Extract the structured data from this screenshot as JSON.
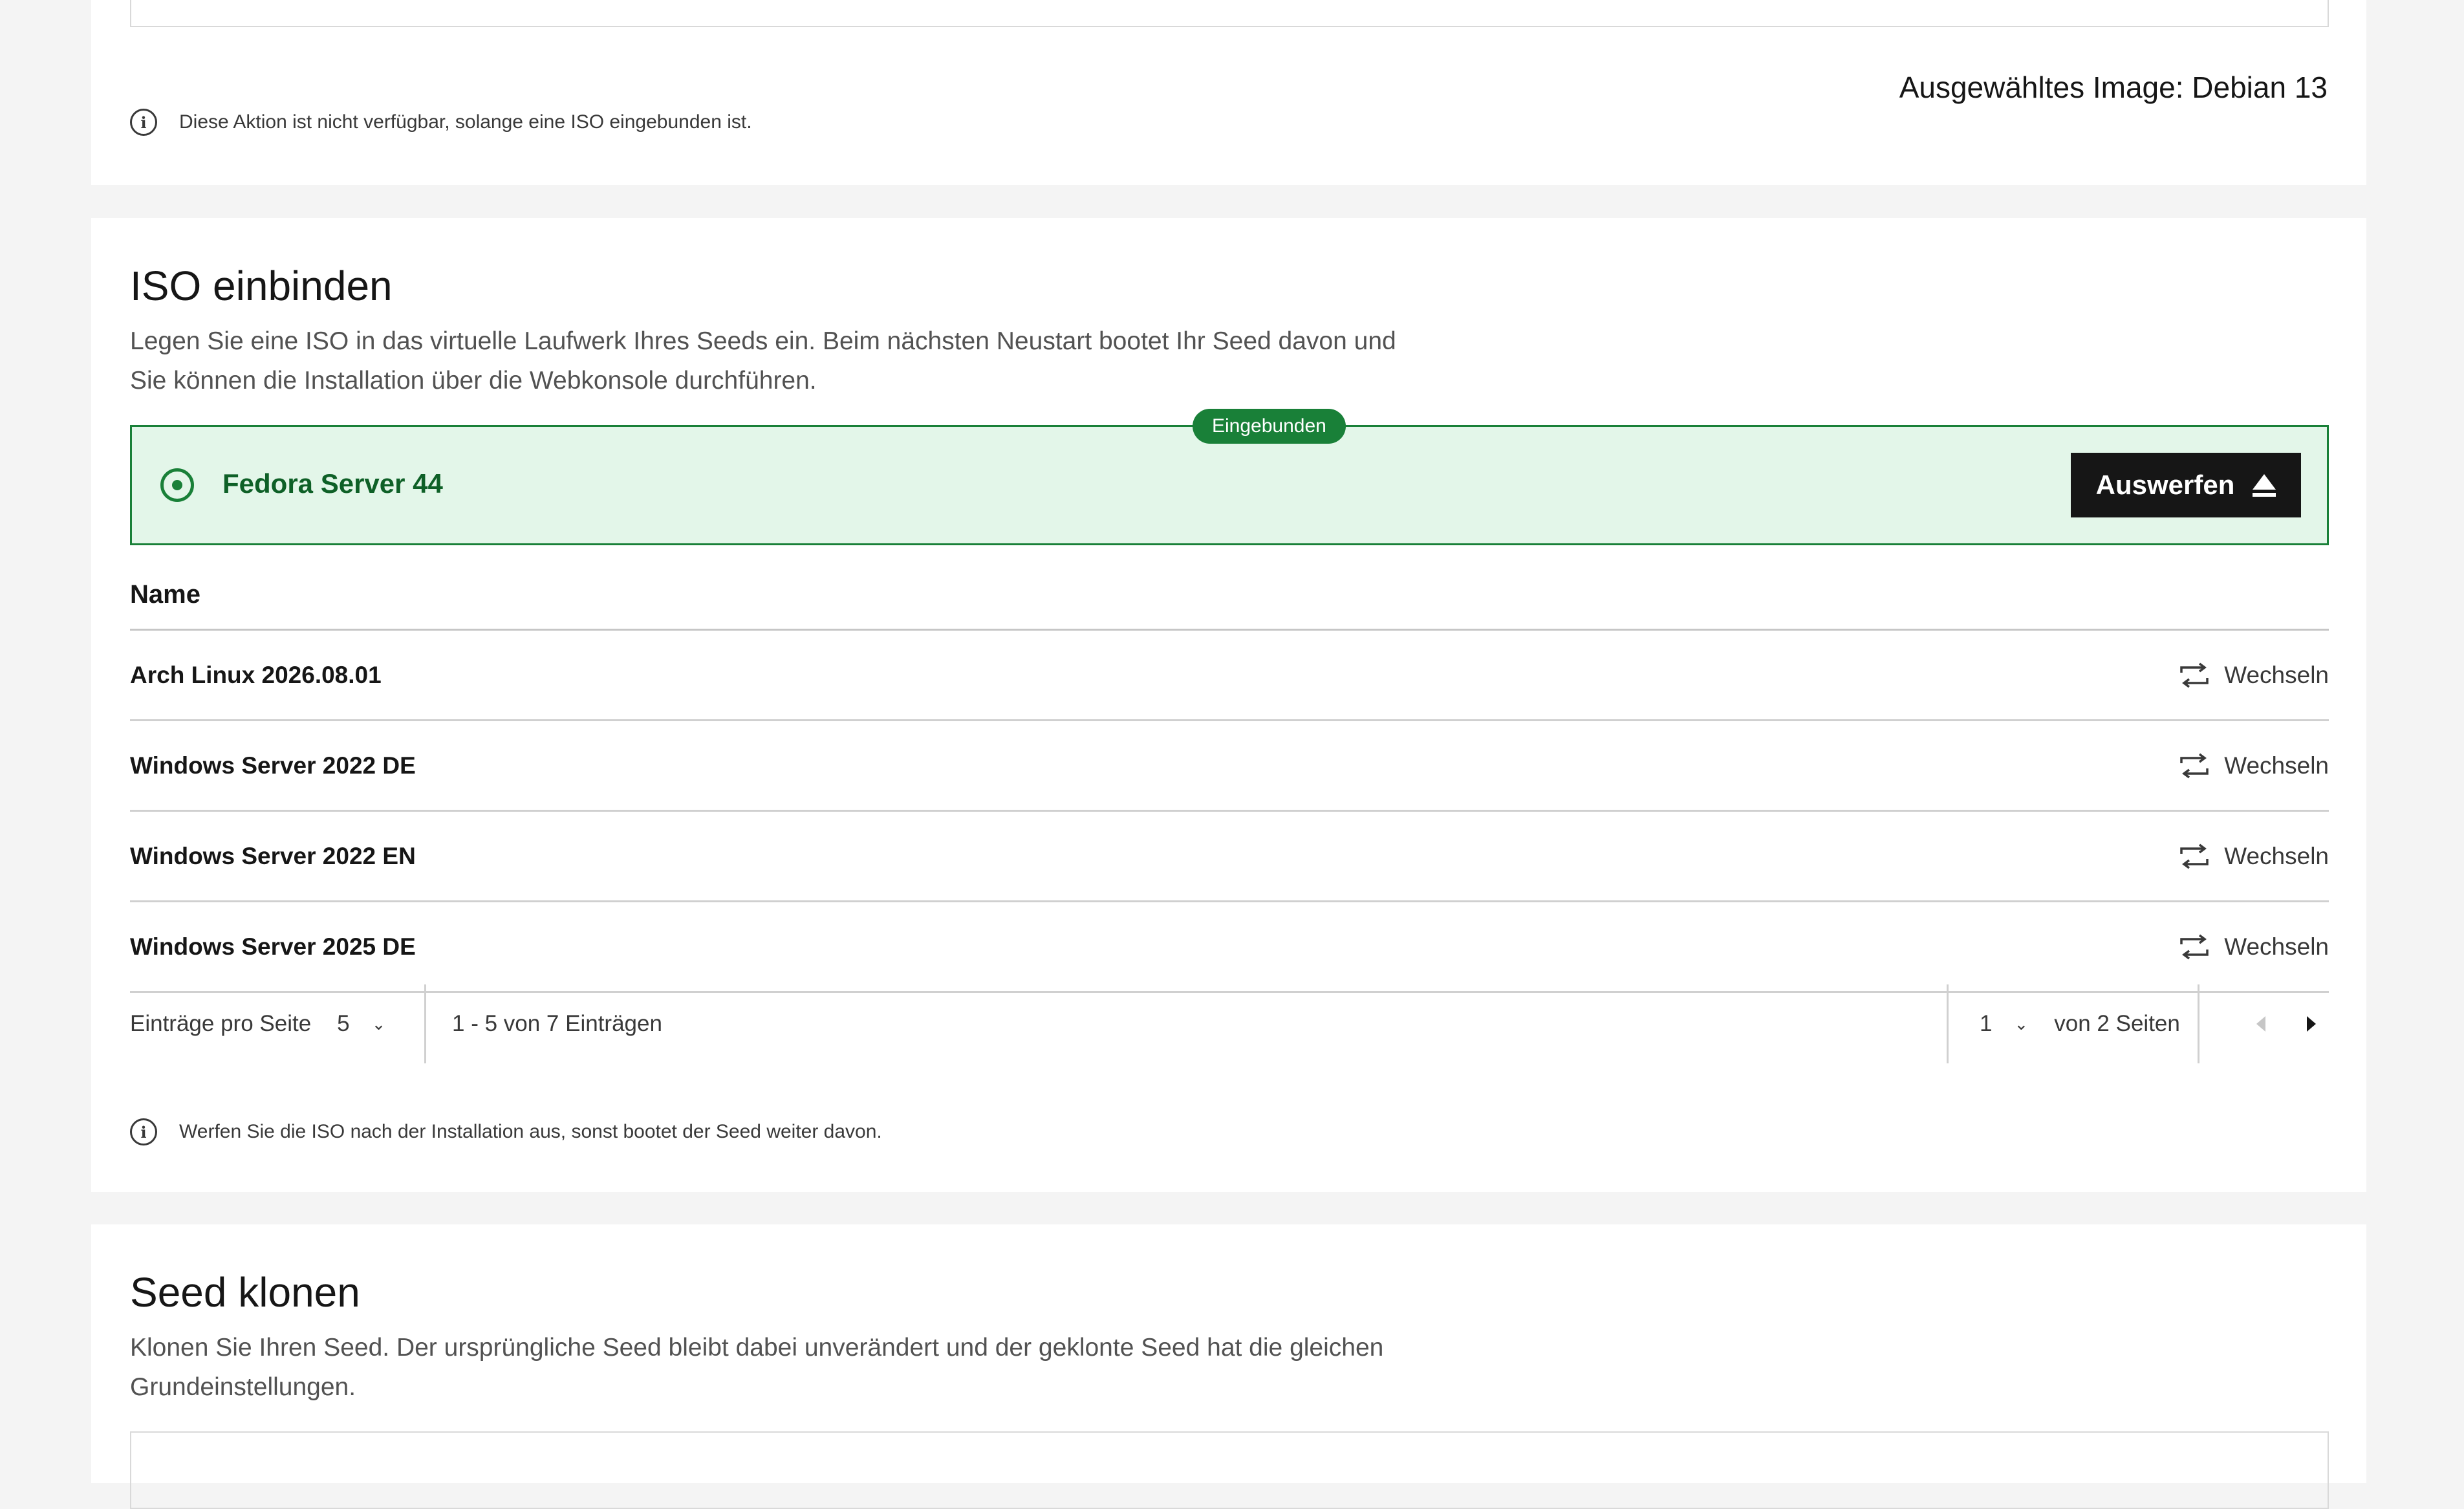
{
  "top_section": {
    "selected_image": "Ausgewähltes Image: Debian 13",
    "info": "Diese Aktion ist nicht verfügbar, solange eine ISO eingebunden ist."
  },
  "iso_section": {
    "title": "ISO einbinden",
    "description": "Legen Sie eine ISO in das virtuelle Laufwerk Ihres Seeds ein. Beim nächsten Neustart bootet Ihr Seed davon und Sie können die Installation über die Webkonsole durchführen.",
    "mounted": {
      "tag": "Eingebunden",
      "name": "Fedora Server 44",
      "eject_label": "Auswerfen",
      "accent_color": "#198038",
      "background_color": "#e3f6e9"
    },
    "table": {
      "column_name": "Name",
      "switch_label": "Wechseln",
      "rows": [
        {
          "name": "Arch Linux 2026.08.01"
        },
        {
          "name": "Windows Server 2022 DE"
        },
        {
          "name": "Windows Server 2022 EN"
        },
        {
          "name": "Windows Server 2025 DE"
        }
      ]
    },
    "pagination": {
      "per_page_label": "Einträge pro Seite",
      "per_page_value": "5",
      "range_text": "1 - 5 von 7 Einträgen",
      "current_page": "1",
      "total_pages_text": "von 2 Seiten"
    },
    "info": "Werfen Sie die ISO nach der Installation aus, sonst bootet der Seed weiter davon."
  },
  "clone_section": {
    "title": "Seed klonen",
    "description": "Klonen Sie Ihren Seed. Der ursprüngliche Seed bleibt dabei unverändert und der geklonte Seed hat die gleichen Grundeinstellungen."
  }
}
